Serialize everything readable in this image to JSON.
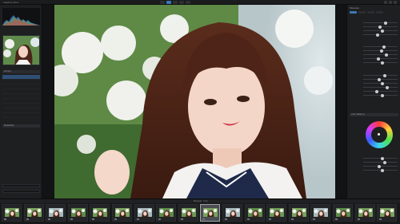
{
  "app": {
    "title": "Capture One"
  },
  "left_panel": {
    "histogram_label": "",
    "section_library": "Library",
    "section_metadata": "Metadata"
  },
  "right_panel": {
    "title": "Exposure",
    "section_color": "Color Balance"
  },
  "filmstrip": {
    "label": "Browser",
    "label2": "Filter"
  },
  "colors": {
    "accent": "#3b78b5",
    "panel_bg": "#1e1f21",
    "viewer_bg": "#121314"
  },
  "icons": [
    "histogram",
    "color-wheel"
  ]
}
